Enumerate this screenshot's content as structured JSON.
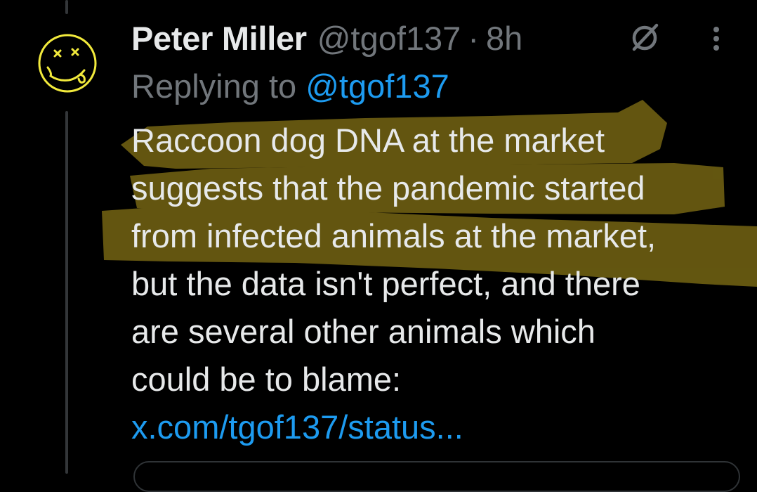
{
  "tweet": {
    "author_name": "Peter Miller",
    "author_handle": "@tgof137",
    "separator": "·",
    "timestamp": "8h",
    "replying_prefix": "Replying to",
    "replying_to": "@tgof137",
    "body_lines": [
      "Raccoon dog DNA at the market",
      "suggests that the pandemic started",
      "from infected animals at the market,",
      "but the data isn't perfect, and there",
      "are several other animals which",
      "could be to blame:"
    ],
    "link_text": "x.com/tgof137/status..."
  },
  "icons": {
    "avatar": "smiley-face-avatar",
    "grok": "grok-slash-icon",
    "more": "more-vertical-icon"
  },
  "colors": {
    "background": "#000000",
    "text_primary": "#e7e9ea",
    "text_secondary": "#71767b",
    "link": "#1d9bf0",
    "highlight": "#a08a1a",
    "avatar_stroke": "#f2ea3c"
  }
}
